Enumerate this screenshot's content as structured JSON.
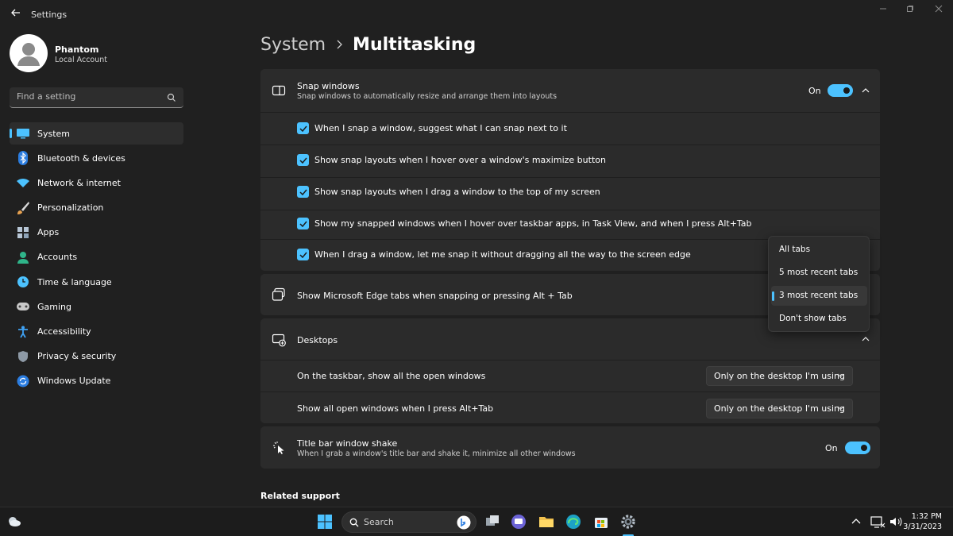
{
  "window": {
    "title": "Settings"
  },
  "user": {
    "name": "Phantom",
    "account_type": "Local Account"
  },
  "search": {
    "placeholder": "Find a setting"
  },
  "sidebar": {
    "items": [
      {
        "label": "System",
        "icon": "monitor-icon"
      },
      {
        "label": "Bluetooth & devices",
        "icon": "bluetooth-icon"
      },
      {
        "label": "Network & internet",
        "icon": "wifi-icon"
      },
      {
        "label": "Personalization",
        "icon": "brush-icon"
      },
      {
        "label": "Apps",
        "icon": "apps-icon"
      },
      {
        "label": "Accounts",
        "icon": "person-icon"
      },
      {
        "label": "Time & language",
        "icon": "globe-clock-icon"
      },
      {
        "label": "Gaming",
        "icon": "gamepad-icon"
      },
      {
        "label": "Accessibility",
        "icon": "accessibility-icon"
      },
      {
        "label": "Privacy & security",
        "icon": "shield-icon"
      },
      {
        "label": "Windows Update",
        "icon": "update-icon"
      }
    ],
    "active_index": 0
  },
  "breadcrumb": {
    "parent": "System",
    "current": "Multitasking"
  },
  "snap": {
    "title": "Snap windows",
    "subtitle": "Snap windows to automatically resize and arrange them into layouts",
    "state": "On",
    "options": [
      "When I snap a window, suggest what I can snap next to it",
      "Show snap layouts when I hover over a window's maximize button",
      "Show snap layouts when I drag a window to the top of my screen",
      "Show my snapped windows when I hover over taskbar apps, in Task View, and when I press Alt+Tab",
      "When I drag a window, let me snap it without dragging all the way to the screen edge"
    ]
  },
  "edge_tabs": {
    "title": "Show Microsoft Edge tabs when snapping or pressing Alt + Tab",
    "dropdown_options": [
      "All tabs",
      "5 most recent tabs",
      "3 most recent tabs",
      "Don't show tabs"
    ],
    "selected_index": 2
  },
  "desktops": {
    "title": "Desktops",
    "rows": [
      {
        "label": "On the taskbar, show all the open windows",
        "value": "Only on the desktop I'm using"
      },
      {
        "label": "Show all open windows when I press Alt+Tab",
        "value": "Only on the desktop I'm using"
      }
    ]
  },
  "shake": {
    "title": "Title bar window shake",
    "subtitle": "When I grab a window's title bar and shake it, minimize all other windows",
    "state": "On"
  },
  "related": {
    "title": "Related support"
  },
  "taskbar": {
    "search_label": "Search",
    "time": "1:32 PM",
    "date": "3/31/2023"
  },
  "colors": {
    "accent": "#4cc2ff",
    "background": "#202020",
    "card": "#2b2b2b"
  }
}
